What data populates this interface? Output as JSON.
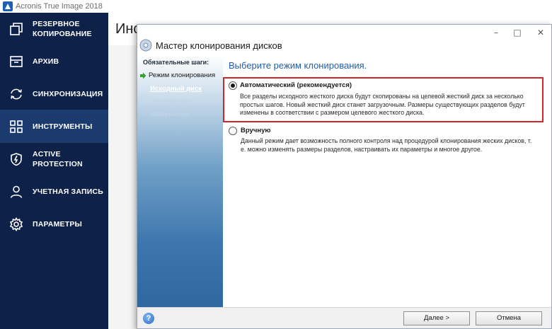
{
  "app": {
    "title": "Acronis True Image 2018"
  },
  "sidebar": {
    "items": [
      {
        "label": "РЕЗЕРВНОЕ\nКОПИРОВАНИЕ",
        "icon": "backup-icon",
        "active": false
      },
      {
        "label": "АРХИВ",
        "icon": "archive-icon",
        "active": false
      },
      {
        "label": "СИНХРОНИЗАЦИЯ",
        "icon": "sync-icon",
        "active": false
      },
      {
        "label": "ИНСТРУМЕНТЫ",
        "icon": "tools-icon",
        "active": true
      },
      {
        "label": "ACTIVE\nPROTECTION",
        "icon": "shield-icon",
        "active": false
      },
      {
        "label": "УЧЕТНАЯ ЗАПИСЬ",
        "icon": "user-icon",
        "active": false
      },
      {
        "label": "ПАРАМЕТРЫ",
        "icon": "gear-icon",
        "active": false
      }
    ]
  },
  "background": {
    "page_title": "Инс"
  },
  "dialog": {
    "title": "Мастер клонирования дисков",
    "controls": {
      "minimize": "–",
      "maximize": "□",
      "close": "✕"
    },
    "steps_header": "Обязательные шаги:",
    "steps": [
      {
        "label": "Режим клонирования",
        "state": "current"
      },
      {
        "label": "Исходный диск",
        "state": "next"
      },
      {
        "label": "Целевой диск",
        "state": "disabled"
      },
      {
        "label": "Завершение",
        "state": "disabled"
      }
    ],
    "heading": "Выберите режим клонирования.",
    "options": [
      {
        "label": "Автоматический (рекомендуется)",
        "selected": true,
        "description": "Все разделы исходного жесткого диска будут скопированы на целевой жесткий диск за несколько простых шагов. Новый жесткий диск станет загрузочным. Размеры существующих разделов будут изменены в соответствии с размером целевого жесткого диска."
      },
      {
        "label": "Вручную",
        "selected": false,
        "description": "Данный режим дает возможность полного контроля над процедурой клонирования жеских дисков, т. е. можно изменять размеры разделов, настраивать их параметры и многое другое."
      }
    ],
    "buttons": {
      "help": "?",
      "next": "Далее >",
      "cancel": "Отмена"
    }
  },
  "colors": {
    "sidebar_bg": "#0e2148",
    "sidebar_active": "#1b3a6e",
    "heading_blue": "#1f5ea8",
    "highlight_red": "#d3262a"
  }
}
